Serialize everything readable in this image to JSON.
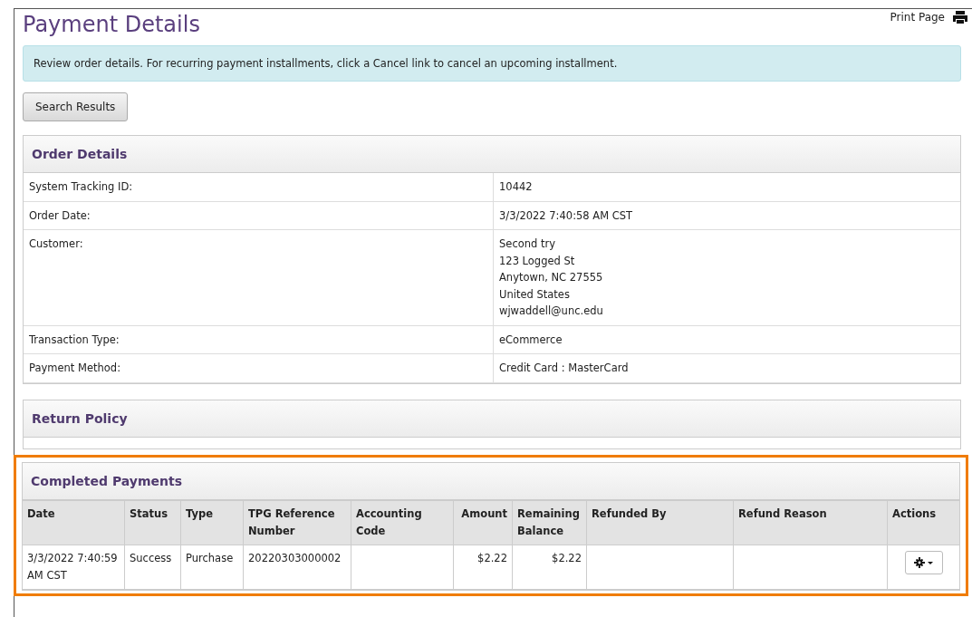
{
  "page": {
    "title": "Payment Details",
    "print_link": "Print Page"
  },
  "info": "Review order details. For recurring payment installments, click a Cancel link to cancel an upcoming installment.",
  "back_button": "Search Results",
  "order_details": {
    "title": "Order Details",
    "rows": [
      {
        "label": "System Tracking ID:",
        "value": [
          "10442"
        ]
      },
      {
        "label": "Order Date:",
        "value": [
          "3/3/2022 7:40:58 AM CST"
        ]
      },
      {
        "label": "Customer:",
        "value": [
          "Second try",
          "123 Logged St",
          "Anytown, NC 27555",
          "United States",
          "wjwaddell@unc.edu"
        ]
      },
      {
        "label": "Transaction Type:",
        "value": [
          "eCommerce"
        ]
      },
      {
        "label": "Payment Method:",
        "value": [
          "Credit Card : MasterCard"
        ]
      }
    ]
  },
  "return_policy": {
    "title": "Return Policy"
  },
  "completed_payments": {
    "title": "Completed Payments",
    "highlighted": true,
    "columns": [
      "Date",
      "Status",
      "Type",
      "TPG Reference Number",
      "Accounting Code",
      "Amount",
      "Remaining Balance",
      "Refunded By",
      "Refund Reason",
      "Actions"
    ],
    "rows": [
      {
        "cells": [
          "3/3/2022 7:40:59 AM CST",
          "Success",
          "Purchase",
          "20220303000002",
          "",
          "$2.22",
          "$2.22",
          "",
          ""
        ]
      }
    ]
  }
}
